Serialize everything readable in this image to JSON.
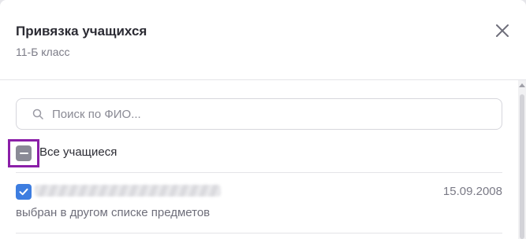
{
  "dialog": {
    "title": "Привязка учащихся",
    "subtitle": "11-Б класс",
    "close_icon": "close-icon"
  },
  "search": {
    "placeholder": "Поиск по ФИО...",
    "value": "",
    "icon": "search-icon"
  },
  "select_all": {
    "label": "Все учащиеся",
    "state": "indeterminate"
  },
  "students": [
    {
      "checked": true,
      "name": "",
      "birth_date": "15.09.2008",
      "note": "выбран в другом списке предметов"
    }
  ],
  "colors": {
    "accent": "#3d7de0",
    "highlight": "#8b1fa8",
    "indeterminate": "#8a8a96"
  }
}
